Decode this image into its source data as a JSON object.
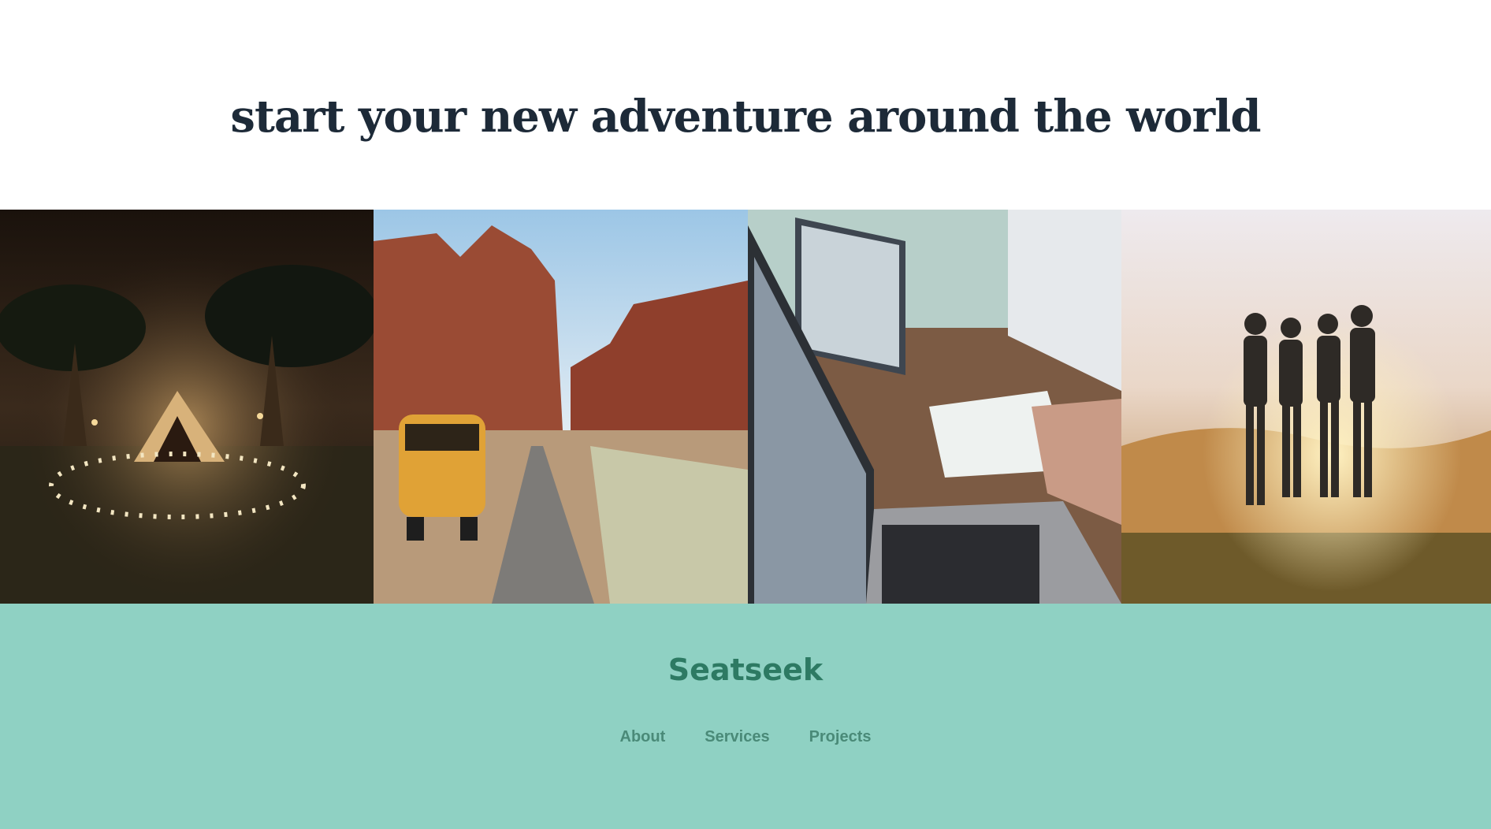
{
  "hero": {
    "title": "start your new adventure around the world"
  },
  "gallery": {
    "photos": [
      {
        "name": "night-camp-tent-photo"
      },
      {
        "name": "desert-road-van-photo"
      },
      {
        "name": "laptop-meeting-photo"
      },
      {
        "name": "friends-sunset-photo"
      }
    ]
  },
  "footer": {
    "brand": "Seatseek",
    "nav": [
      "About",
      "Services",
      "Projects"
    ],
    "background": "#8fd1c3",
    "brand_color": "#2d7a63"
  }
}
